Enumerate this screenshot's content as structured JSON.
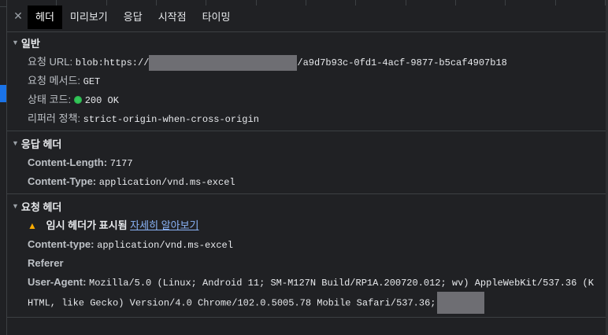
{
  "tabs": [
    "헤더",
    "미리보기",
    "응답",
    "시작점",
    "타이밍"
  ],
  "general": {
    "title": "일반",
    "request_url_label": "요청 URL:",
    "request_url_prefix": "blob:https://",
    "request_url_suffix": "/a9d7b93c-0fd1-4acf-9877-b5caf4907b18",
    "request_method_label": "요청 메서드:",
    "request_method": "GET",
    "status_code_label": "상태 코드:",
    "status_code": "200 OK",
    "status_color": "#34c759",
    "referrer_policy_label": "리퍼러 정책:",
    "referrer_policy": "strict-origin-when-cross-origin"
  },
  "response_headers": {
    "title": "응답 헤더",
    "items": [
      {
        "key": "Content-Length:",
        "value": "7177"
      },
      {
        "key": "Content-Type:",
        "value": "application/vnd.ms-excel"
      }
    ]
  },
  "request_headers": {
    "title": "요청 헤더",
    "warning_text": "임시 헤더가 표시됨",
    "warning_link": "자세히 알아보기",
    "content_type_key": "Content-type:",
    "content_type_value": "application/vnd.ms-excel",
    "referer_key": "Referer",
    "user_agent_key": "User-Agent:",
    "user_agent_line1": "Mozilla/5.0 (Linux; Android 11; SM-M127N Build/RP1A.200720.012; wv) AppleWebKit/537.36 (K",
    "user_agent_line2": "HTML, like Gecko) Version/4.0 Chrome/102.0.5005.78 Mobile Safari/537.36;"
  }
}
